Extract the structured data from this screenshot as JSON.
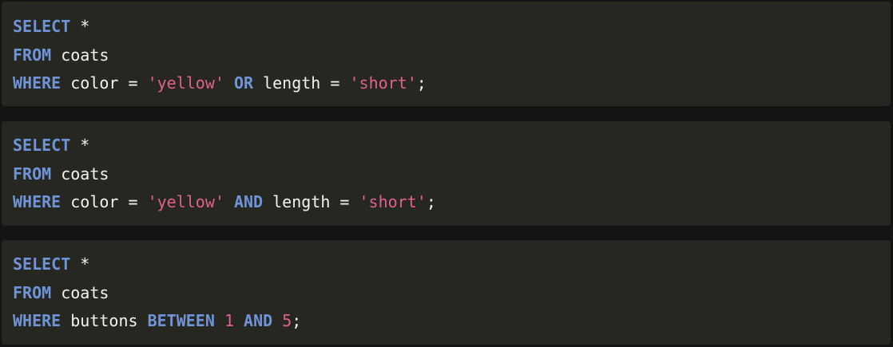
{
  "colors": {
    "background": "#141414",
    "block": "#272722",
    "keyword": "#6f94d8",
    "string": "#e0608f",
    "text": "#f2f2f2"
  },
  "blocks": [
    {
      "lines": [
        [
          {
            "t": "kw",
            "v": "SELECT"
          },
          {
            "t": "plain",
            "v": " *"
          }
        ],
        [
          {
            "t": "kw",
            "v": "FROM"
          },
          {
            "t": "plain",
            "v": " coats"
          }
        ],
        [
          {
            "t": "kw",
            "v": "WHERE"
          },
          {
            "t": "plain",
            "v": " color = "
          },
          {
            "t": "str",
            "v": "'yellow'"
          },
          {
            "t": "plain",
            "v": " "
          },
          {
            "t": "kw",
            "v": "OR"
          },
          {
            "t": "plain",
            "v": " length = "
          },
          {
            "t": "str",
            "v": "'short'"
          },
          {
            "t": "plain",
            "v": ";"
          }
        ]
      ]
    },
    {
      "lines": [
        [
          {
            "t": "kw",
            "v": "SELECT"
          },
          {
            "t": "plain",
            "v": " *"
          }
        ],
        [
          {
            "t": "kw",
            "v": "FROM"
          },
          {
            "t": "plain",
            "v": " coats"
          }
        ],
        [
          {
            "t": "kw",
            "v": "WHERE"
          },
          {
            "t": "plain",
            "v": " color = "
          },
          {
            "t": "str",
            "v": "'yellow'"
          },
          {
            "t": "plain",
            "v": " "
          },
          {
            "t": "kw",
            "v": "AND"
          },
          {
            "t": "plain",
            "v": " length = "
          },
          {
            "t": "str",
            "v": "'short'"
          },
          {
            "t": "plain",
            "v": ";"
          }
        ]
      ]
    },
    {
      "lines": [
        [
          {
            "t": "kw",
            "v": "SELECT"
          },
          {
            "t": "plain",
            "v": " *"
          }
        ],
        [
          {
            "t": "kw",
            "v": "FROM"
          },
          {
            "t": "plain",
            "v": " coats"
          }
        ],
        [
          {
            "t": "kw",
            "v": "WHERE"
          },
          {
            "t": "plain",
            "v": " buttons "
          },
          {
            "t": "kw",
            "v": "BETWEEN"
          },
          {
            "t": "plain",
            "v": " "
          },
          {
            "t": "num",
            "v": "1"
          },
          {
            "t": "plain",
            "v": " "
          },
          {
            "t": "kw",
            "v": "AND"
          },
          {
            "t": "plain",
            "v": " "
          },
          {
            "t": "num",
            "v": "5"
          },
          {
            "t": "plain",
            "v": ";"
          }
        ]
      ]
    }
  ]
}
